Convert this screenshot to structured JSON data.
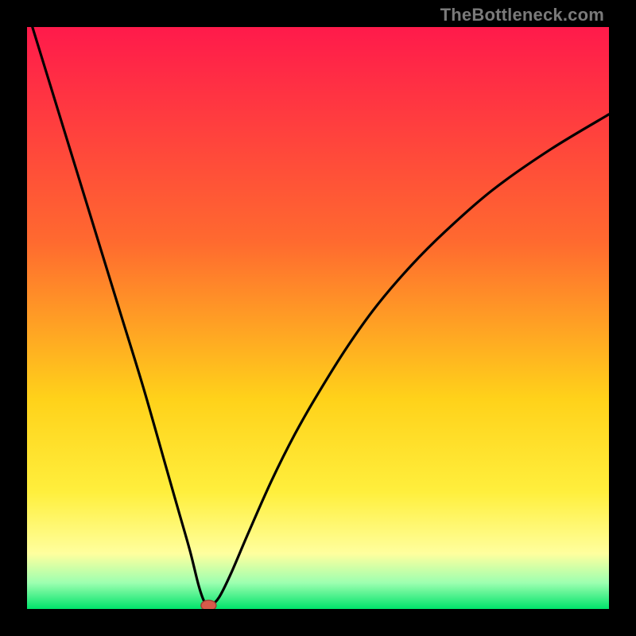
{
  "watermark": "TheBottleneck.com",
  "colors": {
    "frame": "#000000",
    "curve": "#000000",
    "marker_fill": "#d85a4a",
    "marker_stroke": "#9e3f33",
    "grad_top": "#ff1a4b",
    "grad_mid1": "#ff6a2f",
    "grad_mid2": "#ffd21a",
    "grad_yellow": "#ffef3d",
    "grad_lightyellow": "#ffff9e",
    "grad_lightgreen": "#9dffb0",
    "grad_green": "#00e36b"
  },
  "chart_data": {
    "type": "line",
    "title": "",
    "xlabel": "",
    "ylabel": "",
    "xlim": [
      0,
      100
    ],
    "ylim": [
      0,
      100
    ],
    "series": [
      {
        "name": "bottleneck-curve",
        "x": [
          0,
          4,
          8,
          12,
          16,
          20,
          24,
          26,
          28,
          29.5,
          30.5,
          31.5,
          33,
          35,
          38,
          42,
          46,
          50,
          55,
          60,
          66,
          72,
          80,
          90,
          100
        ],
        "y": [
          103,
          90,
          77,
          64,
          51,
          38,
          24,
          17,
          10,
          4,
          1.2,
          0.6,
          2,
          6,
          13,
          22,
          30,
          37,
          45,
          52,
          59,
          65,
          72,
          79,
          85
        ]
      }
    ],
    "marker": {
      "x": 31.2,
      "y": 0.6,
      "rx": 1.3,
      "ry": 0.9
    },
    "gradient_stops": [
      {
        "offset": 0.0,
        "key": "grad_top"
      },
      {
        "offset": 0.37,
        "key": "grad_mid1"
      },
      {
        "offset": 0.64,
        "key": "grad_mid2"
      },
      {
        "offset": 0.8,
        "key": "grad_yellow"
      },
      {
        "offset": 0.905,
        "key": "grad_lightyellow"
      },
      {
        "offset": 0.955,
        "key": "grad_lightgreen"
      },
      {
        "offset": 1.0,
        "key": "grad_green"
      }
    ]
  }
}
